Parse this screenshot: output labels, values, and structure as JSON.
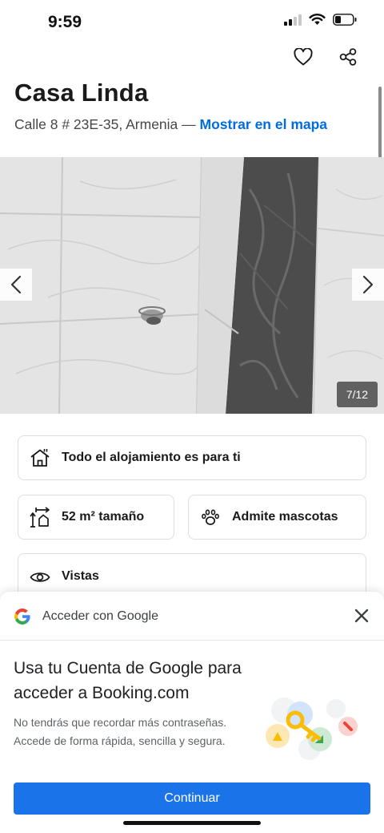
{
  "status_bar": {
    "time": "9:59",
    "battery_icon": "battery-low-icon"
  },
  "top_actions": {
    "favorite_icon": "heart-icon",
    "share_icon": "share-icon"
  },
  "hotel": {
    "name": "Casa Linda",
    "address": "Calle 8 # 23E-35, Armenia",
    "separator": " — ",
    "map_link": "Mostrar en el mapa"
  },
  "gallery": {
    "counter": "7/12",
    "prev_icon": "chevron-left-icon",
    "next_icon": "chevron-right-icon"
  },
  "highlights": {
    "entire_place": {
      "icon": "house-icon",
      "label": "Todo el alojamiento es para ti"
    },
    "size": {
      "icon": "size-icon",
      "label": "52 m² tamaño"
    },
    "pets": {
      "icon": "paw-icon",
      "label": "Admite mascotas"
    },
    "views": {
      "icon": "eye-icon",
      "label": "Vistas"
    }
  },
  "google_signin": {
    "header": "Acceder con Google",
    "heading": "Usa tu Cuenta de Google para acceder a Booking.com",
    "body": "No tendrás que recordar más contraseñas. Accede de forma rápida, sencilla y segura.",
    "continue_label": "Continuar",
    "colors": {
      "button": "#1a73e8",
      "link": "#006ce4"
    }
  }
}
